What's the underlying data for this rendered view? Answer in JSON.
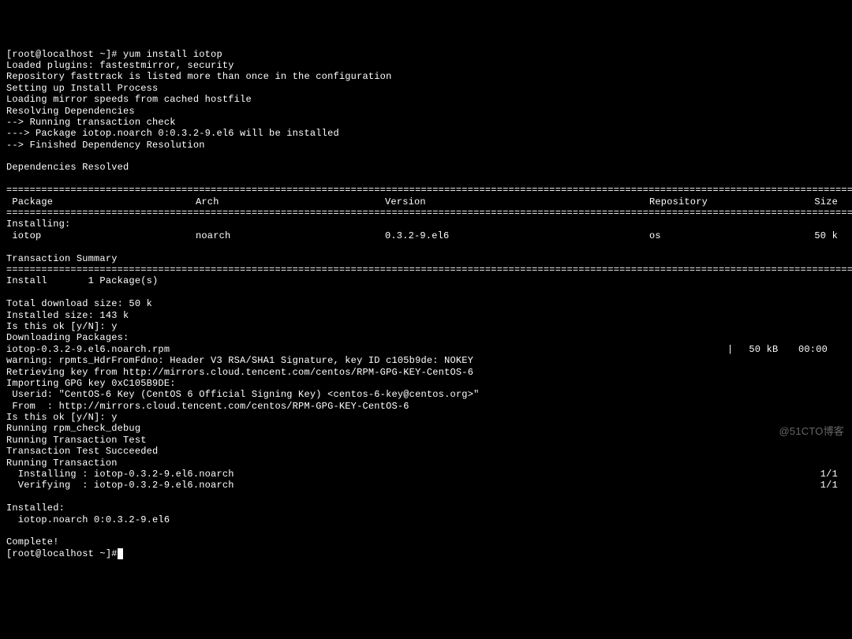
{
  "prompt1": "[root@localhost ~]# ",
  "command": "yum install iotop",
  "lines_pre": [
    "Loaded plugins: fastestmirror, security",
    "Repository fasttrack is listed more than once in the configuration",
    "Setting up Install Process",
    "Loading mirror speeds from cached hostfile",
    "Resolving Dependencies",
    "--> Running transaction check",
    "---> Package iotop.noarch 0:0.3.2-9.el6 will be installed",
    "--> Finished Dependency Resolution",
    "",
    "Dependencies Resolved",
    ""
  ],
  "sep": "============================================================================================================================================================",
  "header": {
    "pkg": " Package",
    "arch": "Arch",
    "ver": "Version",
    "repo": "Repository",
    "size": "Size"
  },
  "installing_label": "Installing:",
  "row1": {
    "pkg": " iotop",
    "arch": "noarch",
    "ver": "0.3.2-9.el6",
    "repo": "os",
    "size": "50 k"
  },
  "txn_summary": "Transaction Summary",
  "install_count": "Install       1 Package(s)",
  "post_lines1": [
    "",
    "Total download size: 50 k",
    "Installed size: 143 k",
    "Is this ok [y/N]: y",
    "Downloading Packages:"
  ],
  "download": {
    "name": "iotop-0.3.2-9.el6.noarch.rpm",
    "bar": "|",
    "size": " 50 kB",
    "time": "00:00"
  },
  "post_lines2": [
    "warning: rpmts_HdrFromFdno: Header V3 RSA/SHA1 Signature, key ID c105b9de: NOKEY",
    "Retrieving key from http://mirrors.cloud.tencent.com/centos/RPM-GPG-KEY-CentOS-6",
    "Importing GPG key 0xC105B9DE:",
    " Userid: \"CentOS-6 Key (CentOS 6 Official Signing Key) <centos-6-key@centos.org>\"",
    " From  : http://mirrors.cloud.tencent.com/centos/RPM-GPG-KEY-CentOS-6",
    "Is this ok [y/N]: y",
    "Running rpm_check_debug",
    "Running Transaction Test",
    "Transaction Test Succeeded",
    "Running Transaction"
  ],
  "installing": {
    "label": "  Installing : iotop-0.3.2-9.el6.noarch",
    "prog": "1/1"
  },
  "verifying": {
    "label": "  Verifying  : iotop-0.3.2-9.el6.noarch",
    "prog": "1/1"
  },
  "installed_lines": [
    "",
    "Installed:",
    "  iotop.noarch 0:0.3.2-9.el6",
    "",
    "Complete!"
  ],
  "prompt2": "[root@localhost ~]#",
  "cursor": " ",
  "watermark": "@51CTO博客"
}
